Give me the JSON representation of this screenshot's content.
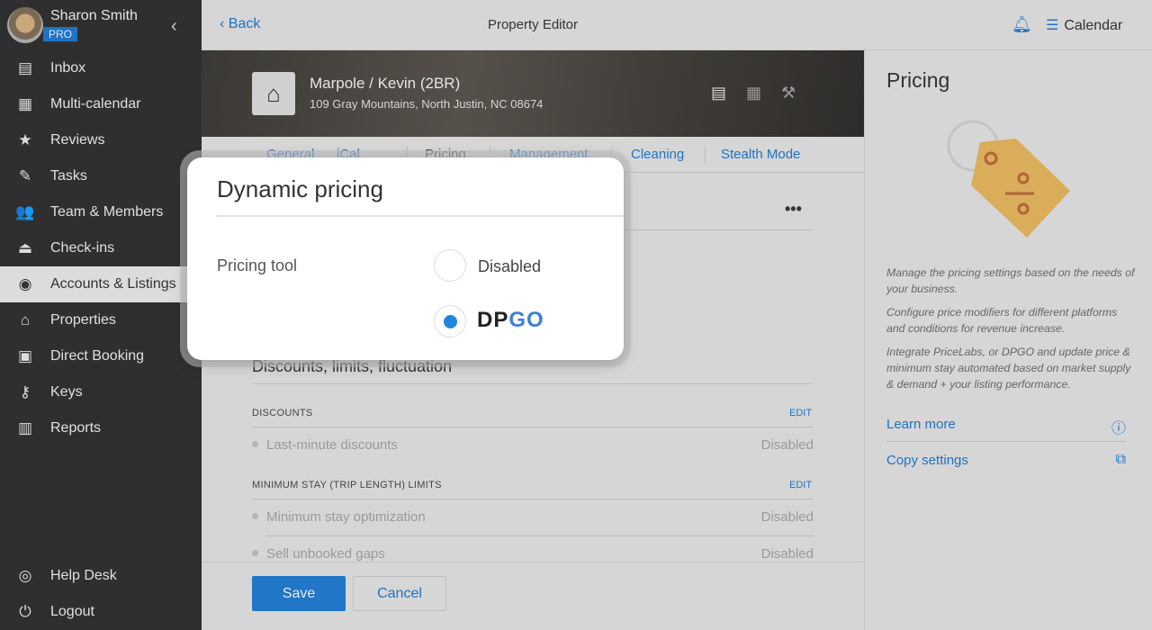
{
  "user": {
    "name": "Sharon Smith",
    "badge": "PRO"
  },
  "sidebar": {
    "items": [
      {
        "label": "Inbox",
        "icon": "inbox-icon",
        "glyph": "▤"
      },
      {
        "label": "Multi-calendar",
        "icon": "calendar-icon",
        "glyph": "▦"
      },
      {
        "label": "Reviews",
        "icon": "star-icon",
        "glyph": "★"
      },
      {
        "label": "Tasks",
        "icon": "tasks-icon",
        "glyph": "✎"
      },
      {
        "label": "Team & Members",
        "icon": "team-icon",
        "glyph": "👥"
      },
      {
        "label": "Check-ins",
        "icon": "bell-desk-icon",
        "glyph": "⏏"
      },
      {
        "label": "Accounts & Listings",
        "icon": "account-icon",
        "glyph": "◉"
      },
      {
        "label": "Properties",
        "icon": "home-icon",
        "glyph": "⌂"
      },
      {
        "label": "Direct Booking",
        "icon": "code-window-icon",
        "glyph": "▣"
      },
      {
        "label": "Keys",
        "icon": "key-icon",
        "glyph": "⚷"
      },
      {
        "label": "Reports",
        "icon": "reports-icon",
        "glyph": "▥"
      }
    ],
    "bottom": [
      {
        "label": "Help Desk",
        "icon": "lifebuoy-icon",
        "glyph": "◎"
      },
      {
        "label": "Logout",
        "icon": "power-icon",
        "glyph": "⏻"
      }
    ]
  },
  "topbar": {
    "back": "Back",
    "title": "Property Editor",
    "calendar": "Calendar"
  },
  "listing": {
    "name": "Marpole / Kevin (2BR)",
    "address": "109 Gray Mountains, North Justin, NC 08674"
  },
  "tabs": [
    "General",
    "iCal",
    "Pricing",
    "Management",
    "Cleaning",
    "Stealth Mode"
  ],
  "active_tab": "Pricing",
  "section": {
    "title": "Discounts, limits, fluctuation",
    "discounts": {
      "caption": "DISCOUNTS",
      "edit": "EDIT",
      "rows": [
        {
          "label": "Last-minute discounts",
          "value": "Disabled"
        }
      ]
    },
    "min_stay": {
      "caption": "MINIMUM STAY (TRIP LENGTH) LIMITS",
      "edit": "EDIT",
      "rows": [
        {
          "label": "Minimum stay optimization",
          "value": "Disabled"
        },
        {
          "label": "Sell unbooked gaps",
          "value": "Disabled"
        }
      ]
    }
  },
  "footer": {
    "save": "Save",
    "cancel": "Cancel"
  },
  "right": {
    "title": "Pricing",
    "desc": [
      "Manage the pricing settings based on the needs of your business.",
      "Configure price modifiers for different platforms and conditions for revenue increase.",
      "Integrate PriceLabs, or DPGO and update price & minimum stay automated based on market supply & demand + your listing performance."
    ],
    "learn_more": "Learn more",
    "copy_settings": "Copy settings"
  },
  "popup": {
    "title": "Dynamic pricing",
    "label": "Pricing tool",
    "options": [
      {
        "label": "Disabled",
        "selected": false
      },
      {
        "label": "DPGO",
        "selected": true
      }
    ]
  },
  "colors": {
    "accent": "#1f73c4",
    "sidebar": "#2f2f2f",
    "radio": "#1f86e0"
  }
}
